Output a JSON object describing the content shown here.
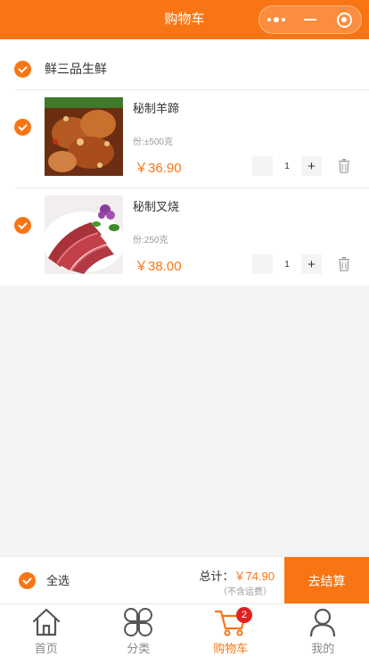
{
  "header": {
    "title": "购物车"
  },
  "store": {
    "name": "鲜三品生鲜"
  },
  "items": [
    {
      "name": "秘制羊蹄",
      "spec": "份:±500克",
      "price": "￥36.90",
      "qty": "1",
      "minus": "",
      "plus": "+"
    },
    {
      "name": "秘制叉烧",
      "spec": "份:250克",
      "price": "￥38.00",
      "qty": "1",
      "minus": "",
      "plus": "+"
    }
  ],
  "footer": {
    "select_all": "全选",
    "total_label": "总计：",
    "total_amount": "￥74.90",
    "shipping_note": "（不含运费）",
    "checkout": "去结算"
  },
  "tabbar": {
    "items": [
      {
        "label": "首页",
        "icon": "home-icon"
      },
      {
        "label": "分类",
        "icon": "category-icon"
      },
      {
        "label": "购物车",
        "icon": "cart-icon",
        "badge": "2"
      },
      {
        "label": "我的",
        "icon": "user-icon"
      }
    ]
  },
  "colors": {
    "accent": "#f97514",
    "badge": "#e02020"
  }
}
